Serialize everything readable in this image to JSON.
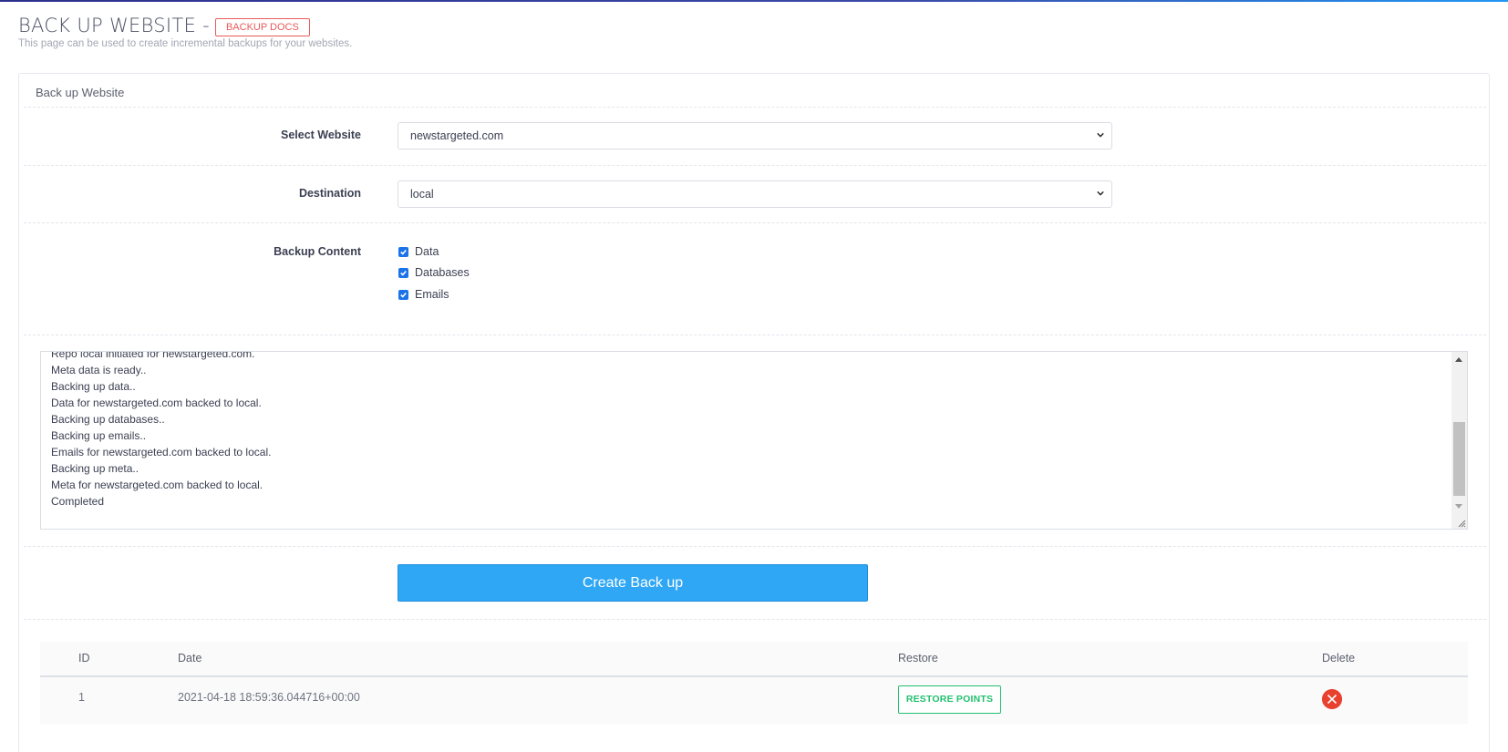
{
  "header": {
    "title": "BACK UP WEBSITE -",
    "docs_badge": "BACKUP DOCS",
    "subtitle": "This page can be used to create incremental backups for your websites."
  },
  "panel": {
    "heading": "Back up Website"
  },
  "form": {
    "website_label": "Select Website",
    "website_value": "newstargeted.com",
    "destination_label": "Destination",
    "destination_value": "local",
    "content_label": "Backup Content",
    "options": [
      {
        "label": "Data",
        "checked": true
      },
      {
        "label": "Databases",
        "checked": true
      },
      {
        "label": "Emails",
        "checked": true
      }
    ]
  },
  "log": {
    "lines": [
      "Repo local initiated for newstargeted.com.",
      "Meta data is ready..",
      "Backing up data..",
      "Data for newstargeted.com backed to local.",
      "Backing up databases..",
      "Backing up emails..",
      "Emails for newstargeted.com backed to local.",
      "Backing up meta..",
      "Meta for newstargeted.com backed to local.",
      "Completed"
    ]
  },
  "actions": {
    "create_label": "Create Back up"
  },
  "table": {
    "columns": [
      "ID",
      "Date",
      "Restore",
      "Delete"
    ],
    "rows": [
      {
        "id": "1",
        "date": "2021-04-18 18:59:36.044716+00:00",
        "restore_label": "RESTORE POINTS"
      }
    ]
  },
  "colors": {
    "primary": "#2fa7f5",
    "success": "#21c06e",
    "danger": "#e8412e",
    "docs_badge": "#e85a5a"
  }
}
